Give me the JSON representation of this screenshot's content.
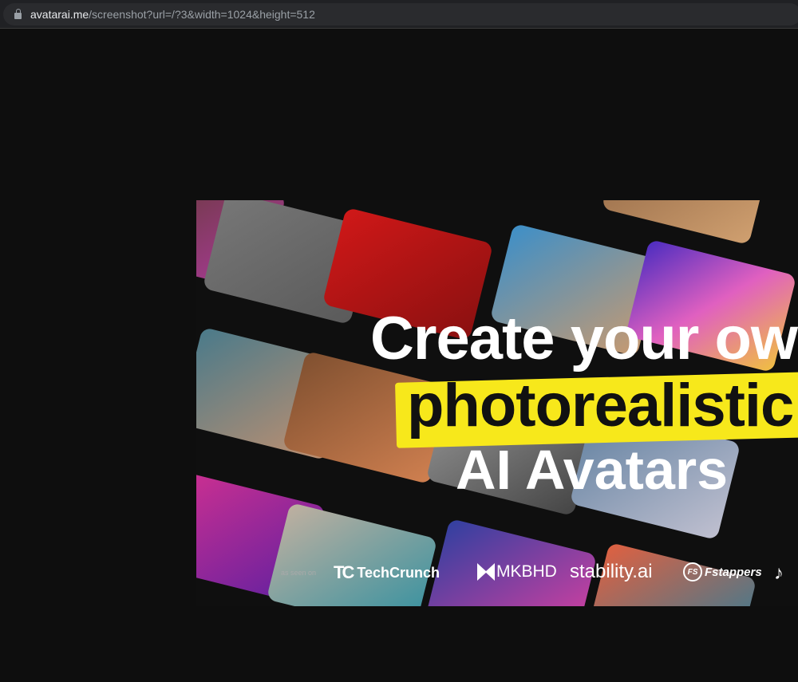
{
  "browser": {
    "url_host": "avatarai.me",
    "url_path": "/screenshot?url=/?3&width=1024&height=512"
  },
  "banner": {
    "line1": "Create your own",
    "line2": "photorealistic",
    "line3": "AI Avatars",
    "as_seen_on": "as seen on",
    "logos": [
      "TechCrunch",
      "MKBHD",
      "stability.ai",
      "Fstappers"
    ],
    "fs_mark": "FS",
    "highlight_color": "#f7e81b"
  }
}
